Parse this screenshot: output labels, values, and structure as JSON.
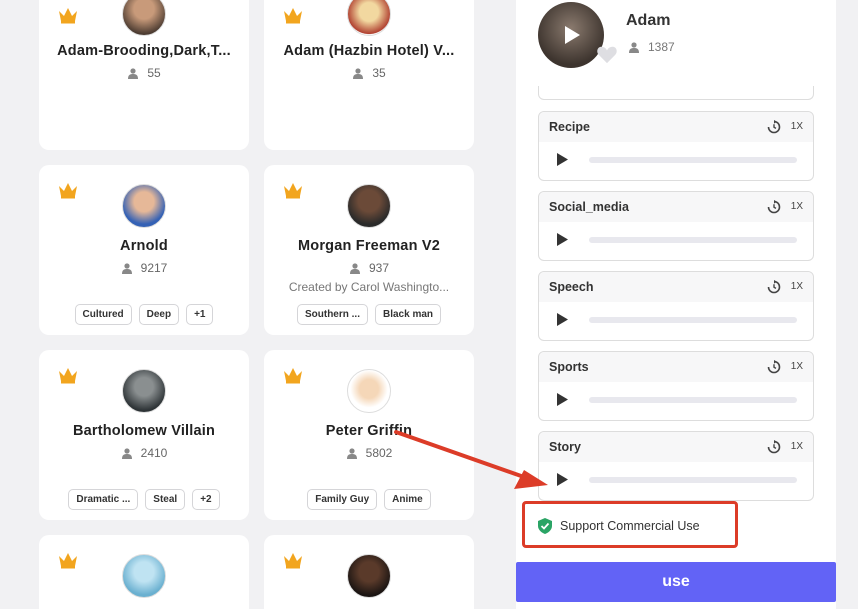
{
  "cards": [
    {
      "name": "Adam-Brooding,Dark,T...",
      "count": "55",
      "creator": "",
      "tags": []
    },
    {
      "name": "Adam (Hazbin Hotel) V...",
      "count": "35",
      "creator": "",
      "tags": []
    },
    {
      "name": "Arnold",
      "count": "9217",
      "creator": "",
      "tags": [
        "Cultured",
        "Deep",
        "+1"
      ]
    },
    {
      "name": "Morgan Freeman V2",
      "count": "937",
      "creator": "Created by Carol Washingto...",
      "tags": [
        "Southern ...",
        "Black man"
      ]
    },
    {
      "name": "Bartholomew Villain",
      "count": "2410",
      "creator": "",
      "tags": [
        "Dramatic ...",
        "Steal",
        "+2"
      ]
    },
    {
      "name": "Peter Griffin",
      "count": "5802",
      "creator": "",
      "tags": [
        "Family Guy",
        "Anime"
      ]
    },
    {
      "name": "",
      "count": "",
      "creator": "",
      "tags": []
    },
    {
      "name": "",
      "count": "",
      "creator": "",
      "tags": []
    }
  ],
  "panel": {
    "title": "Adam",
    "count": "1387",
    "samples": [
      {
        "label": "Recipe",
        "speed": "1X"
      },
      {
        "label": "Social_media",
        "speed": "1X"
      },
      {
        "label": "Speech",
        "speed": "1X"
      },
      {
        "label": "Sports",
        "speed": "1X"
      },
      {
        "label": "Story",
        "speed": "1X"
      }
    ],
    "support_label": "Support Commercial Use",
    "use_label": "use"
  },
  "colors": {
    "accent": "#6263f6",
    "crown": "#f2a51e",
    "annotation": "#dc3c28",
    "shield": "#2aa465"
  },
  "icons": [
    "crown-icon",
    "user-icon",
    "play-icon",
    "heart-icon",
    "replay-icon",
    "shield-check-icon",
    "arrow-annotation"
  ]
}
